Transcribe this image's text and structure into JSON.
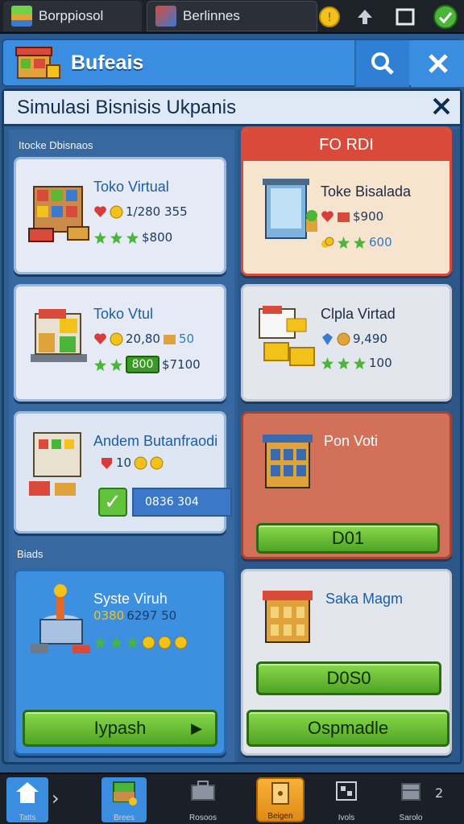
{
  "tabs": [
    {
      "label": "Borppiosol"
    },
    {
      "label": "Berlinnes"
    }
  ],
  "header": {
    "title": "Bufeais"
  },
  "dialog": {
    "title": "Simulasi Bisnisis Ukpanis",
    "section_top": "Itocke Dbisnaos",
    "section_bottom": "Biads"
  },
  "cards": {
    "c1": {
      "name": "Toko Virtual",
      "v1": "1/280 355",
      "v2": "$800"
    },
    "c2": {
      "header": "FO RDI",
      "name": "Toke Bisalada",
      "v1": "$900",
      "v2": "600"
    },
    "c3": {
      "name": "Toko Vtul",
      "v1": "20,80",
      "v1b": "50",
      "badge": "800",
      "v2": "$7100"
    },
    "c4": {
      "name": "Clpla Virtad",
      "v1": "9,490",
      "v2": "100"
    },
    "c5": {
      "name": "Andem Butanfraodi",
      "v1": "10",
      "field": "0836 304"
    },
    "c6": {
      "name": "Pon Voti",
      "button": "D01"
    },
    "c7": {
      "name": "Syste Viruh",
      "v1": "0380",
      "v1b": "6297 50",
      "button": "Iypash"
    },
    "c8": {
      "name": "Saka Magm",
      "button1": "D0S0",
      "button2": "Ospmadle"
    }
  },
  "nav": {
    "items": [
      {
        "label": "Tatts"
      },
      {
        "label": "Brees"
      },
      {
        "label": "Rosoos"
      },
      {
        "label": "Beigen"
      },
      {
        "label": "Ivols"
      },
      {
        "label": "Sarolo"
      }
    ],
    "badge": "2"
  },
  "colors": {
    "accent": "#3b8de0",
    "green": "#5cb82e",
    "red": "#d94a3a",
    "dark": "#1d2229"
  }
}
